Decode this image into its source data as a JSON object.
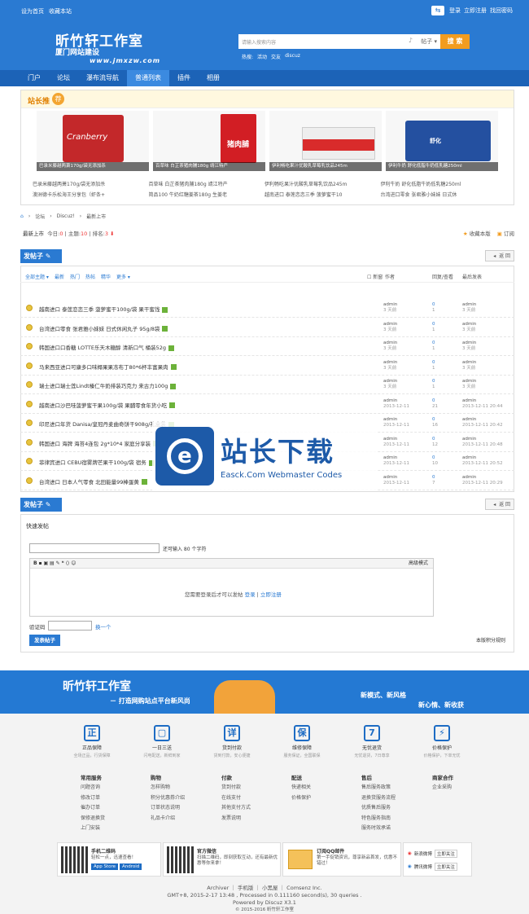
{
  "topbar": {
    "set_home": "设为首页",
    "bookmark": "收藏本站",
    "login": "登录",
    "register": "立即注册",
    "find_pw": "找回密码"
  },
  "header": {
    "site_name": "昕竹轩工作室",
    "sub": "厦门网站建设",
    "url": "www.jmxzw.com",
    "search_placeholder": "请输入搜索内容",
    "search_cat": "帖子",
    "search_btn": "搜 索",
    "hot_label": "热搜:",
    "hot": [
      "活动",
      "交友",
      "discuz"
    ]
  },
  "nav": [
    "门户",
    "论坛",
    "瀑布流导航",
    "普通列表",
    "插件",
    "相册"
  ],
  "recommend": {
    "title": "站长推",
    "badge": "荐",
    "slides": [
      "巴录米藤越两萧170g/袋无添加杀",
      "百草味 白芷茶猪肉脯180g 靖江特产",
      "伊利畅吃果汁优酸乳草莓乳饮品245m",
      "伊利牛奶 舒化低脂牛奶低乳糖250ml"
    ],
    "links": [
      [
        "巴录米藤越两萧170g/袋无添加杀",
        "百草味 白芷茶猪肉脯180g 靖江特产",
        "伊利畅吃果汁优酸乳草莓乳饮品245m",
        "伊利牛奶 舒化低脂牛奶低乳糖250ml"
      ],
      [
        "澳洲德卡乐松海王分享包（虾条+",
        "简品100 牛奶红糖姜茶180g 生姜老",
        "越南进口 泰莲恋恋三季 菠萝蜜干10",
        "台湾进口零食 张君雅小妹妹 日式休"
      ]
    ]
  },
  "crumb": [
    "论坛",
    "Discuz!",
    "最新上市"
  ],
  "stats": {
    "name": "最新上市",
    "today_label": "今日:",
    "today": "0",
    "threads_label": "主题:",
    "threads": "10",
    "rank_label": "排名:",
    "rank": "3",
    "fav": "收藏本版",
    "rss": "订阅"
  },
  "post_btn": "发帖子",
  "back": "返 回",
  "filters": [
    "全部主题",
    "最新",
    "热门",
    "热帖",
    "精华",
    "更多"
  ],
  "cols": {
    "new": "新窗",
    "author": "作者",
    "reply": "回复/查看",
    "last": "最后发表"
  },
  "threads": [
    {
      "title": "越南进口 泰莲恋恋三季 菠萝蜜干100g/袋 果干蜜饯",
      "a": "admin",
      "ad": "3 天前",
      "r": "0",
      "v": "1",
      "l": "admin",
      "ld": "3 天前"
    },
    {
      "title": "台湾进口零食 张君雅小妹妹 日式休闲丸子 95g/8袋",
      "a": "admin",
      "ad": "3 天前",
      "r": "0",
      "v": "1",
      "l": "admin",
      "ld": "3 天前"
    },
    {
      "title": "韩国进口口香糖 LOTTE乐天木糖醇 清新口气 桶装52g",
      "a": "admin",
      "ad": "3 天前",
      "r": "0",
      "v": "1",
      "l": "admin",
      "ld": "3 天前"
    },
    {
      "title": "马来西亚进口可康多口味椰果果冻布丁80*6杯丰富果肉",
      "a": "admin",
      "ad": "3 天前",
      "r": "0",
      "v": "1",
      "l": "admin",
      "ld": "3 天前"
    },
    {
      "title": "瑞士进口瑞士莲Lindt榛仁牛奶排装巧克力 来古力100g",
      "a": "admin",
      "ad": "3 天前",
      "r": "0",
      "v": "1",
      "l": "admin",
      "ld": "3 天前"
    },
    {
      "title": "越南进口沙巴哇菠萝蜜干果100g/袋 果脯零食年货小吃",
      "a": "admin",
      "ad": "2013-12-11",
      "r": "0",
      "v": "21",
      "l": "admin",
      "ld": "2013-12-11 20:44"
    },
    {
      "title": "印尼进口年货 Danisa/皇冠丹麦曲奇饼干908g/礼盒装",
      "a": "admin",
      "ad": "2013-12-11",
      "r": "0",
      "v": "16",
      "l": "admin",
      "ld": "2013-12-11 20:42"
    },
    {
      "title": "韩国进口 海牌 海苔4连包 2g*10*4 家庭分享装",
      "a": "admin",
      "ad": "2013-12-11",
      "r": "0",
      "v": "12",
      "l": "admin",
      "ld": "2013-12-11 20:48"
    },
    {
      "title": "菲律宾进口 CEBU宿雾牌芒果干100g/袋 宿务",
      "a": "admin",
      "ad": "2013-12-11",
      "r": "0",
      "v": "10",
      "l": "admin",
      "ld": "2013-12-11 20:52"
    },
    {
      "title": "台湾进口 日本人气零食 北田能量99棒蛋黄",
      "a": "admin",
      "ad": "2013-12-11",
      "r": "0",
      "v": "7",
      "l": "admin",
      "ld": "2013-12-11 20:29"
    }
  ],
  "watermark": {
    "title": "站长下载",
    "sub": "Easck.Com Webmaster Codes"
  },
  "quick": {
    "title": "快速发帖",
    "limit": "还可输入 80 个字符",
    "advanced": "高级模式",
    "need_login": "您需要登录后才可以发帖",
    "login": "登录",
    "register": "立即注册",
    "captcha": "验证码",
    "change": "换一个",
    "submit": "发表帖子",
    "rules": "本版积分规则"
  },
  "banner": {
    "t1": "昕竹轩工作室",
    "t2": "－ 打造网购站点平台新风尚",
    "t3": "新模式、新风格",
    "t4": "新心情、新收获"
  },
  "services": [
    {
      "i": "正",
      "n": "正品保障",
      "d": "全场正品，行货保障"
    },
    {
      "i": "▢",
      "n": "一日三送",
      "d": "闪电配送，新鲜到家"
    },
    {
      "i": "详",
      "n": "货到付款",
      "d": "货到付款，安心便捷"
    },
    {
      "i": "保",
      "n": "维修保障",
      "d": "服务保证，全国联保"
    },
    {
      "i": "7",
      "n": "无忧退货",
      "d": "无忧退货，7日尊享"
    },
    {
      "i": "⚡",
      "n": "价格保护",
      "d": "价格保护，下单无忧"
    }
  ],
  "fcols": [
    {
      "h": "常用服务",
      "items": [
        "问题咨询",
        "修改订单",
        "催办订单",
        "保修退换货",
        "上门安装"
      ]
    },
    {
      "h": "购物",
      "items": [
        "怎样购物",
        "积分优惠券介绍",
        "订单状态说明",
        "礼品卡介绍"
      ]
    },
    {
      "h": "付款",
      "items": [
        "货到付款",
        "在线支付",
        "其他支付方式",
        "发票说明"
      ]
    },
    {
      "h": "配送",
      "items": [
        "快递相关",
        "价格保护"
      ]
    },
    {
      "h": "售后",
      "items": [
        "售后服务政策",
        "退换货服务流程",
        "优质售后服务",
        "特色服务指南",
        "服务时效承诺"
      ]
    },
    {
      "h": "商家合作",
      "items": [
        "企业采购"
      ]
    }
  ],
  "qr": {
    "app_t": "手机二维码",
    "app_d": "轻松一点，迅速查看！",
    "app_store": "App Store",
    "android": "Android",
    "wx_t": "官方微信",
    "wx_d": "扫描二维码，即刻获取互动，还有最新优惠等你来拿！",
    "qq_t": "订阅QQ邮件",
    "qq_d": "第一手促销资讯，尊享新品首发，优惠不错过！",
    "weibo": "新浪微博",
    "tweibo": "腾讯微博",
    "follow": "立即关注"
  },
  "copy": {
    "l1": "Archiver ｜ 手机版 ｜ 小黑屋 ｜ Comsenz Inc.",
    "l2": "GMT+8, 2015-2-17 13:48 , Processed in 0.111160 second(s), 30 queries .",
    "l3": "Powered by Discuz X3.1",
    "l4": "© 2015-2016 昕竹轩工作室"
  },
  "colors": {
    "brand": "#2a7ad2",
    "nav": "#1c63b7",
    "accent": "#f29c1f"
  }
}
